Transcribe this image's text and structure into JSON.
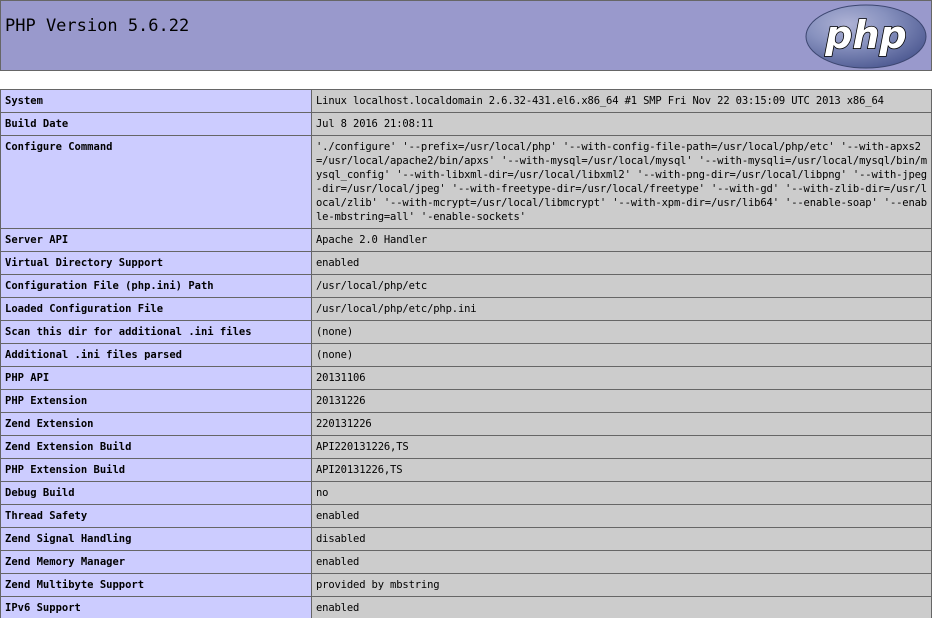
{
  "header": {
    "title": "PHP Version 5.6.22",
    "logo_text": "php"
  },
  "colors": {
    "header_bg": "#9999cc",
    "key_bg": "#ccccff",
    "value_bg": "#cccccc",
    "logo_bg": "#6c7eb7",
    "border": "#666666"
  },
  "rows": [
    {
      "key": "System",
      "value": "Linux localhost.localdomain 2.6.32-431.el6.x86_64 #1 SMP Fri Nov 22 03:15:09 UTC 2013 x86_64"
    },
    {
      "key": "Build Date",
      "value": "Jul 8 2016 21:08:11"
    },
    {
      "key": "Configure Command",
      "value": "'./configure' '--prefix=/usr/local/php' '--with-config-file-path=/usr/local/php/etc' '--with-apxs2=/usr/local/apache2/bin/apxs' '--with-mysql=/usr/local/mysql' '--with-mysqli=/usr/local/mysql/bin/mysql_config' '--with-libxml-dir=/usr/local/libxml2' '--with-png-dir=/usr/local/libpng' '--with-jpeg-dir=/usr/local/jpeg' '--with-freetype-dir=/usr/local/freetype' '--with-gd' '--with-zlib-dir=/usr/local/zlib' '--with-mcrypt=/usr/local/libmcrypt' '--with-xpm-dir=/usr/lib64' '--enable-soap' '--enable-mbstring=all' '-enable-sockets'"
    },
    {
      "key": "Server API",
      "value": "Apache 2.0 Handler"
    },
    {
      "key": "Virtual Directory Support",
      "value": "enabled"
    },
    {
      "key": "Configuration File (php.ini) Path",
      "value": "/usr/local/php/etc"
    },
    {
      "key": "Loaded Configuration File",
      "value": "/usr/local/php/etc/php.ini"
    },
    {
      "key": "Scan this dir for additional .ini files",
      "value": "(none)"
    },
    {
      "key": "Additional .ini files parsed",
      "value": "(none)"
    },
    {
      "key": "PHP API",
      "value": "20131106"
    },
    {
      "key": "PHP Extension",
      "value": "20131226"
    },
    {
      "key": "Zend Extension",
      "value": "220131226"
    },
    {
      "key": "Zend Extension Build",
      "value": "API220131226,TS"
    },
    {
      "key": "PHP Extension Build",
      "value": "API20131226,TS"
    },
    {
      "key": "Debug Build",
      "value": "no"
    },
    {
      "key": "Thread Safety",
      "value": "enabled"
    },
    {
      "key": "Zend Signal Handling",
      "value": "disabled"
    },
    {
      "key": "Zend Memory Manager",
      "value": "enabled"
    },
    {
      "key": "Zend Multibyte Support",
      "value": "provided by mbstring"
    },
    {
      "key": "IPv6 Support",
      "value": "enabled"
    }
  ]
}
